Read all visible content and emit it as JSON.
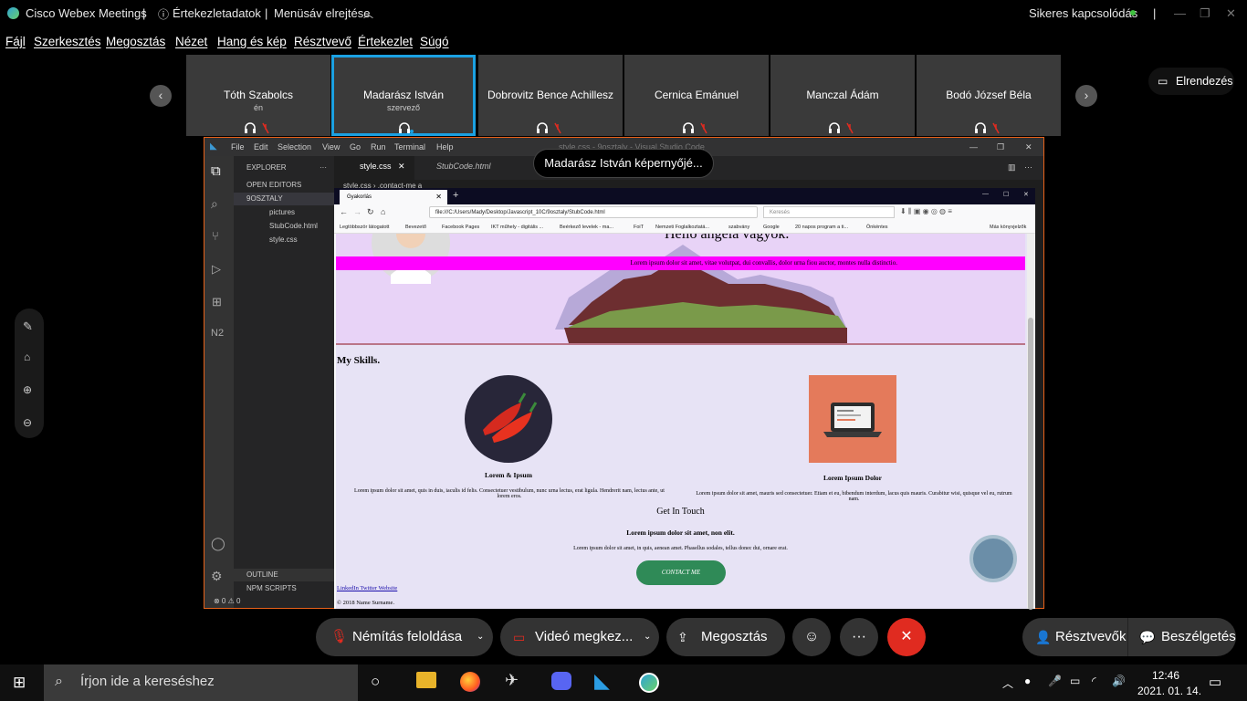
{
  "titlebar": {
    "app": "Cisco Webex Meetings",
    "sep1": "|",
    "meeting_info": "Értekezletadatok",
    "sep2": "|",
    "hide_menu": "Menüsáv elrejtése",
    "status": "Sikeres kapcsolódás",
    "sep3": "|"
  },
  "menu": [
    "Fájl",
    "Szerkesztés",
    "Megosztás",
    "Nézet",
    "Hang és kép",
    "Résztvevő",
    "Értekezlet",
    "Súgó"
  ],
  "participants": [
    {
      "name": "Tóth Szabolcs",
      "sub": "én"
    },
    {
      "name": "Madarász István",
      "sub": "szervező"
    },
    {
      "name": "Dobrovitz Bence Achillesz",
      "sub": ""
    },
    {
      "name": "Cernica Emánuel",
      "sub": ""
    },
    {
      "name": "Manczal Ádám",
      "sub": ""
    },
    {
      "name": "Bodó József Béla",
      "sub": ""
    }
  ],
  "layout_button": "Elrendezés",
  "share_tooltip": "Madarász István képernyőjé...",
  "vscode": {
    "menu": [
      "File",
      "Edit",
      "Selection",
      "View",
      "Go",
      "Run",
      "Terminal",
      "Help"
    ],
    "title": "style.css - 9osztaly - Visual Studio Code",
    "explorer": "EXPLORER",
    "open_editors": "OPEN EDITORS",
    "folder": "9OSZTALY",
    "files": [
      "pictures",
      "StubCode.html",
      "style.css"
    ],
    "outline": "OUTLINE",
    "npm": "NPM SCRIPTS",
    "tab1": "style.css",
    "tab2": "StubCode.html",
    "breadcrumb1": "style.css",
    "breadcrumb2": ".contact-me a",
    "status": "⊗ 0 ⚠ 0"
  },
  "firefox": {
    "tab": "Gyakorlás",
    "url": "file:///C:/Users/Mady/Desktop/Javascript_10C/9osztaly/StubCode.html",
    "search_placeholder": "Keresés",
    "bookmarks": [
      "Legtöbbször látogatott",
      "Bevezető",
      "Facebook Pages",
      "IKT műhely - digitális ...",
      "Beérkező levelek - ma...",
      "FoiT",
      "Nemzeti Foglalkoztatá...",
      "szabvány",
      "Google",
      "20 napos program a ti...",
      "Önkéntes",
      "Más könyvjelzők"
    ]
  },
  "webpage": {
    "heading_partial": "Hello angela vagyok.",
    "lorem_bar": "Lorem ipsum dolor sit amet, vitae volutpat, dui convallis, dolor urna fiou auctor, montes nulla distinctio.",
    "skills_title": "My Skills.",
    "skill1_title": "Lorem & Ipsum",
    "skill1_text": "Lorem ipsum dolor sit amet, quis in duis, iaculis id felis. Consectetuer vestibulum, nunc urna lectus, erat ligula. Hendrerit nam, lectus ante, ut lorem eros.",
    "skill2_title": "Lorem Ipsum Dolor",
    "skill2_text": "Lorem ipsum dolor sit amet, mauris sed consectetuer. Etiam et eu, bibendum interdum, lacus quis mauris. Curabitur wisi, quisque vel eu, rutrum nam.",
    "contact_title": "Get In Touch",
    "contact_sub": "Lorem ipsum dolor sit amet, non elit.",
    "contact_text": "Lorem ipsum dolor sit amet, in quis, aenean amet. Phasellus sodales, tellus donec dui, ornare erat.",
    "contact_button": "CONTACT ME",
    "links": "LinkedIn Twitter Website",
    "footer": "© 2018 Name Surname."
  },
  "controls": {
    "mute": "Némítás feloldása",
    "video": "Videó megkez...",
    "share": "Megosztás",
    "participants": "Résztvevők",
    "chat": "Beszélgetés"
  },
  "taskbar": {
    "search_placeholder": "Írjon ide a kereséshez",
    "time": "12:46",
    "date": "2021. 01. 14."
  },
  "colors": {
    "accent": "#1ba1e2",
    "danger": "#e02b20",
    "vscode_border": "#e8621a",
    "magenta": "#ff00ff"
  }
}
